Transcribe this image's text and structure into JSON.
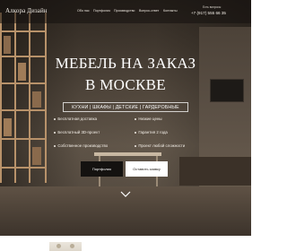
{
  "header": {
    "logo": "Алкора Дизайн",
    "nav": [
      "Обо нас",
      "Портфолио",
      "Производство",
      "Вопрос-ответ",
      "Контакты"
    ],
    "contact_label": "Есть вопросы",
    "phone": "+7 (917) 555 66 35"
  },
  "hero": {
    "title_line1": "МЕБЕЛЬ НА ЗАКАЗ",
    "title_line2": "В МОСКВЕ",
    "subtitle": "КУХНИ | ШКАФЫ | ДЕТСКИЕ | ГАРДЕРОБНЫЕ",
    "features_left": [
      "Бесплатная доставка",
      "Бесплатный 3D-проект",
      "Собственное производство"
    ],
    "features_right": [
      "Низкие цены",
      "Гарантия 2 года",
      "Проект любой сложности"
    ],
    "btn_portfolio": "Портфолио",
    "btn_request": "Оставить заявку",
    "scroll_icon": "chevron-down-icon"
  },
  "colors": {
    "overlay": "#16120e",
    "button_dark": "#141210",
    "button_light": "#ffffff",
    "text_light": "#ffffff"
  }
}
